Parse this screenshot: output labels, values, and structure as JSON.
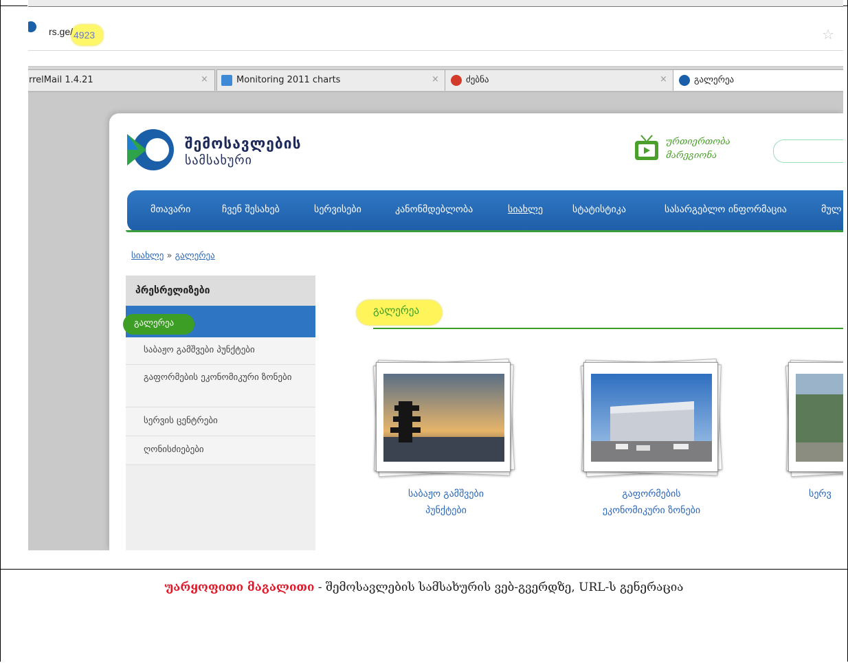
{
  "browser": {
    "url_domain": "rs.ge/",
    "url_path": "4923",
    "tabs": [
      {
        "label": "rrelMail 1.4.21",
        "close": "×"
      },
      {
        "label": "Monitoring 2011 charts",
        "close": "×"
      },
      {
        "label": "ძებნა",
        "close": "×"
      },
      {
        "label": "გალერეა"
      }
    ]
  },
  "site": {
    "logo_line1": "შემოსავლების",
    "logo_line2": "სამსახური",
    "tv_line1": "ურთიერთობა",
    "tv_line2": "მარეგიონა",
    "nav": [
      "მთავარი",
      "ჩვენ შესახებ",
      "სერვისები",
      "კანონმდებლობა",
      "სიახლე",
      "სტატისტიკა",
      "სასარგებლო ინფორმაცია",
      "მულ"
    ],
    "breadcrumb": {
      "home": "სიახლე",
      "sep": "»",
      "current": "გალერეა"
    },
    "sidebar": {
      "header": "პრესრელიზები",
      "active": "გალერეა",
      "items": [
        "საბაჟო გამშვები პუნქტები",
        "გაფორმების ეკონომიკური ზონები",
        "სერვის ცენტრები",
        "ღონისძიებები"
      ]
    },
    "gallery": {
      "title": "გალერეა",
      "photos": [
        {
          "caption_l1": "საბაჟო გამშვები",
          "caption_l2": "პუნქტები"
        },
        {
          "caption_l1": "გაფორმების",
          "caption_l2": "ეკონომიკური ზონები"
        },
        {
          "caption_l1": "სერვ"
        }
      ]
    }
  },
  "caption": {
    "highlight": "უარყოფითი მაგალითი",
    "text": " - შემოსავლების სამსახურის ვებ-გვერდზე, URL-ს გენერაცია"
  },
  "colors": {
    "nav_blue": "#2f78c4",
    "accent_green": "#3a9e26",
    "highlight_yellow": "#fff55a",
    "caption_red": "#e0192a"
  }
}
